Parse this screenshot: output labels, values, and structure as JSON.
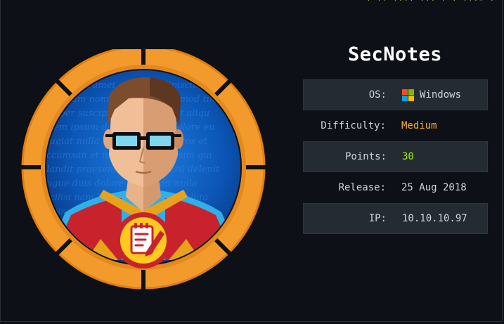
{
  "machine": {
    "name": "SecNotes",
    "info": [
      {
        "label": "OS:",
        "value": "Windows",
        "icon": "windows-icon"
      },
      {
        "label": "Difficulty:",
        "value": "Medium"
      },
      {
        "label": "Points:",
        "value": "30"
      },
      {
        "label": "Release:",
        "value": "25 Aug 2018"
      },
      {
        "label": "IP:",
        "value": "10.10.10.97"
      }
    ]
  },
  "colors": {
    "badge_ring": "#f29b2c",
    "difficulty_medium": "#ffab40",
    "points": "#9fef00",
    "windows_logo": [
      "#f25022",
      "#7fba00",
      "#00a4ef",
      "#ffb900"
    ]
  }
}
